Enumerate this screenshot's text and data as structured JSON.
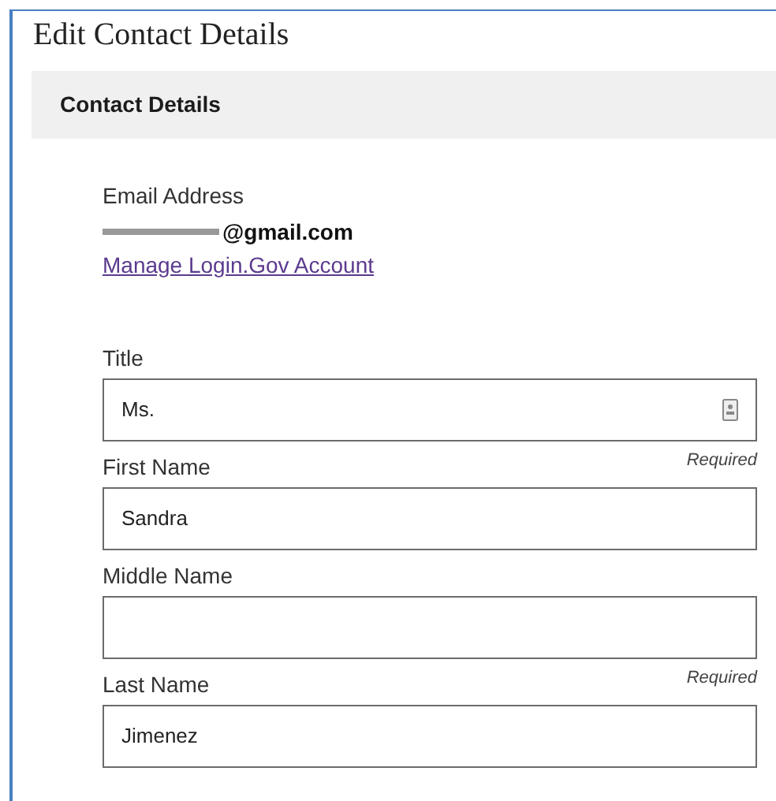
{
  "page_title": "Edit Contact Details",
  "section": {
    "title": "Contact Details"
  },
  "email": {
    "label": "Email Address",
    "value": "@gmail.com",
    "link": "Manage Login.Gov Account"
  },
  "fields": [
    {
      "label": "Title",
      "value": "Ms.",
      "autofill_icon": true
    },
    {
      "label": "First Name",
      "value": "Sandra",
      "required_note": "Required",
      "autofill_icon": false
    },
    {
      "label": "Middle Name",
      "autofill_icon": false
    },
    {
      "label": "Last Name",
      "value": "Jimenez",
      "required_note": "Required",
      "autofill_icon": false
    }
  ]
}
